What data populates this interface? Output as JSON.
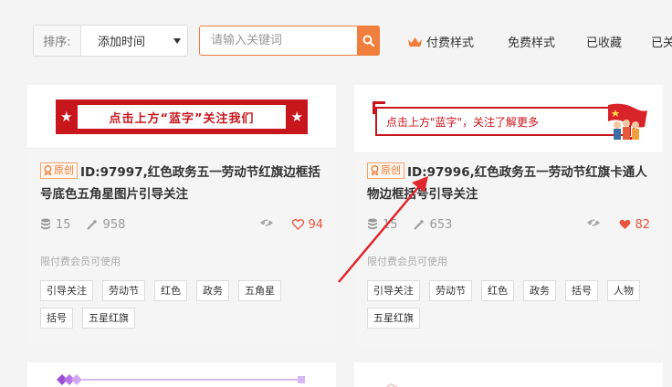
{
  "toolbar": {
    "sort_label": "排序:",
    "sort_value": "添加时间",
    "search_placeholder": "请输入关键词",
    "nav": [
      "付费样式",
      "免费样式",
      "已收藏",
      "已关"
    ]
  },
  "cards": [
    {
      "banner": "点击上方“蓝字”关注我们",
      "badge": "原创",
      "title": "ID:97997,红色政务五一劳动节红旗边框括号底色五角星图片引导关注",
      "stack_count": "15",
      "wand_count": "958",
      "likes": "94",
      "limit": "限付费会员可使用",
      "tags": [
        "引导关注",
        "劳动节",
        "红色",
        "政务",
        "五角星",
        "括号",
        "五星红旗"
      ]
    },
    {
      "banner": "点击上方\"蓝字\"，关注了解更多",
      "badge": "原创",
      "title": "ID:97996,红色政务五一劳动节红旗卡通人物边框括号引导关注",
      "stack_count": "15",
      "wand_count": "653",
      "likes": "82",
      "limit": "限付费会员可使用",
      "tags": [
        "引导关注",
        "劳动节",
        "红色",
        "政务",
        "括号",
        "人物",
        "五星红旗"
      ]
    }
  ],
  "colors": {
    "accent": "#f07e3c",
    "banner_red": "#c8161d",
    "like": "#e8553e",
    "arrow": "#e0262d"
  }
}
